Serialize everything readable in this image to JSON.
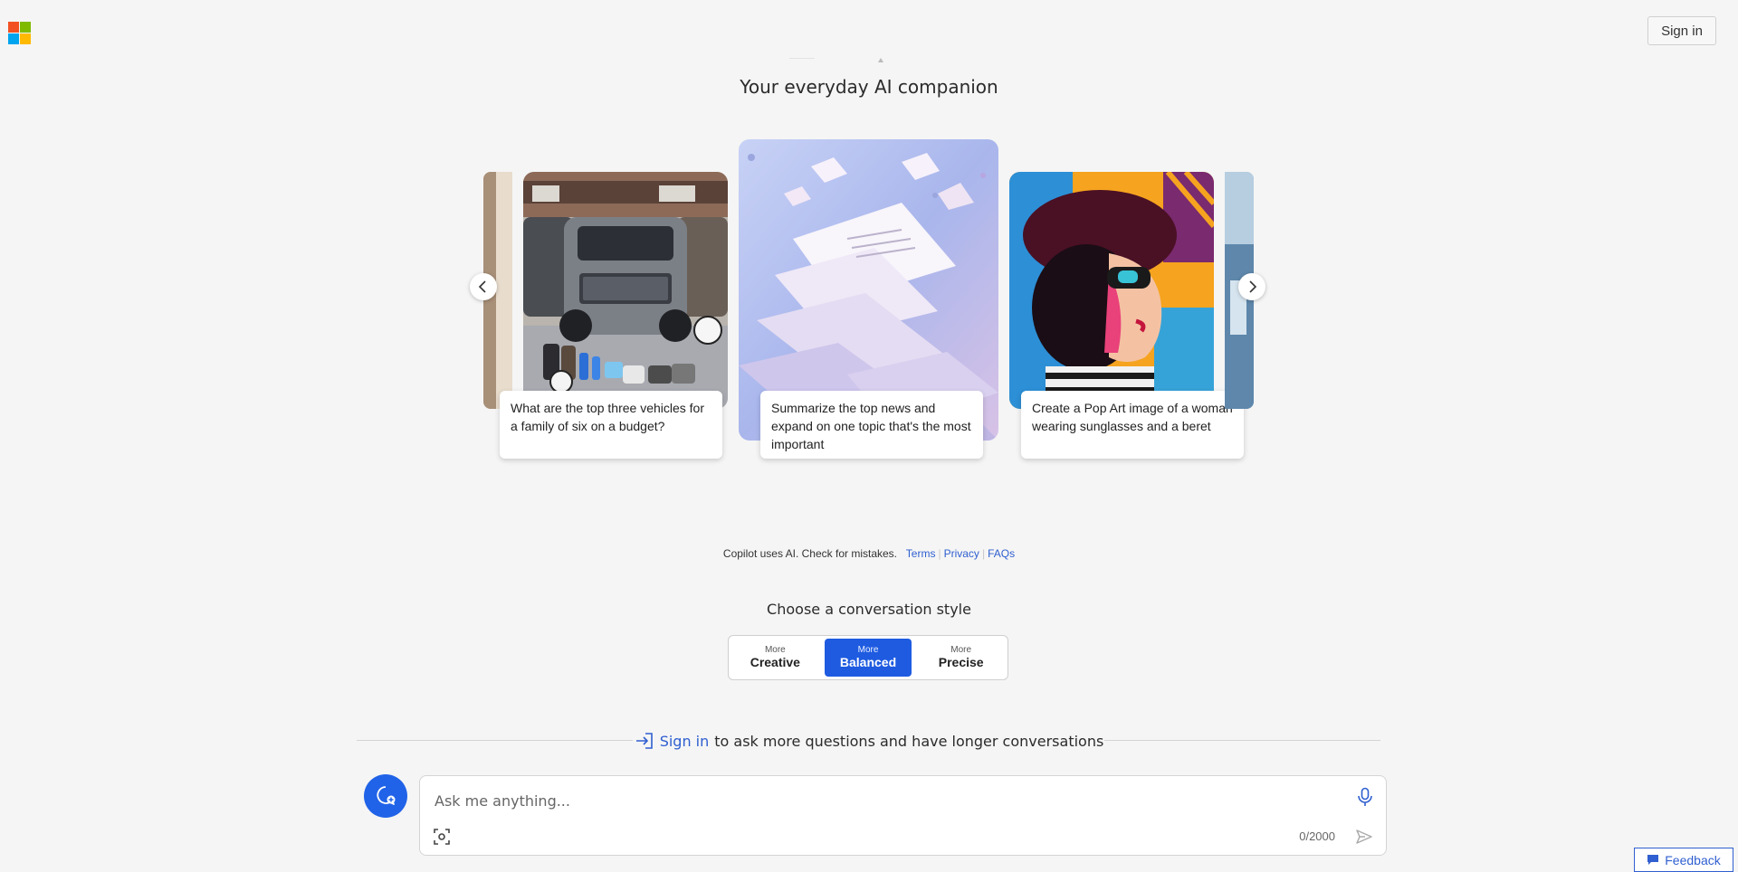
{
  "header": {
    "logo_colors": [
      "#f25022",
      "#7fba00",
      "#00a4ef",
      "#ffb900"
    ],
    "signin_label": "Sign in"
  },
  "tagline": "Your everyday AI companion",
  "carousel": {
    "cards": [
      {
        "image": "car-family-image",
        "prompt": "What are the top three vehicles for a family of six on a budget?"
      },
      {
        "image": "news-papers-image",
        "prompt": "Summarize the top news and expand on one topic that's the most important"
      },
      {
        "image": "pop-art-woman-image",
        "prompt": "Create a Pop Art image of a woman wearing sunglasses and a beret"
      }
    ]
  },
  "disclaimer": {
    "text": "Copilot uses AI. Check for mistakes.",
    "links": [
      "Terms",
      "Privacy",
      "FAQs"
    ]
  },
  "conversation_style": {
    "heading": "Choose a conversation style",
    "options": [
      {
        "small": "More",
        "label": "Creative",
        "active": false
      },
      {
        "small": "More",
        "label": "Balanced",
        "active": true
      },
      {
        "small": "More",
        "label": "Precise",
        "active": false
      }
    ],
    "accent": "#1e5be0"
  },
  "signin_prompt": {
    "link": "Sign in",
    "text": "to ask more questions and have longer conversations"
  },
  "chat": {
    "placeholder": "Ask me anything...",
    "counter": "0/2000"
  },
  "feedback_label": "Feedback"
}
